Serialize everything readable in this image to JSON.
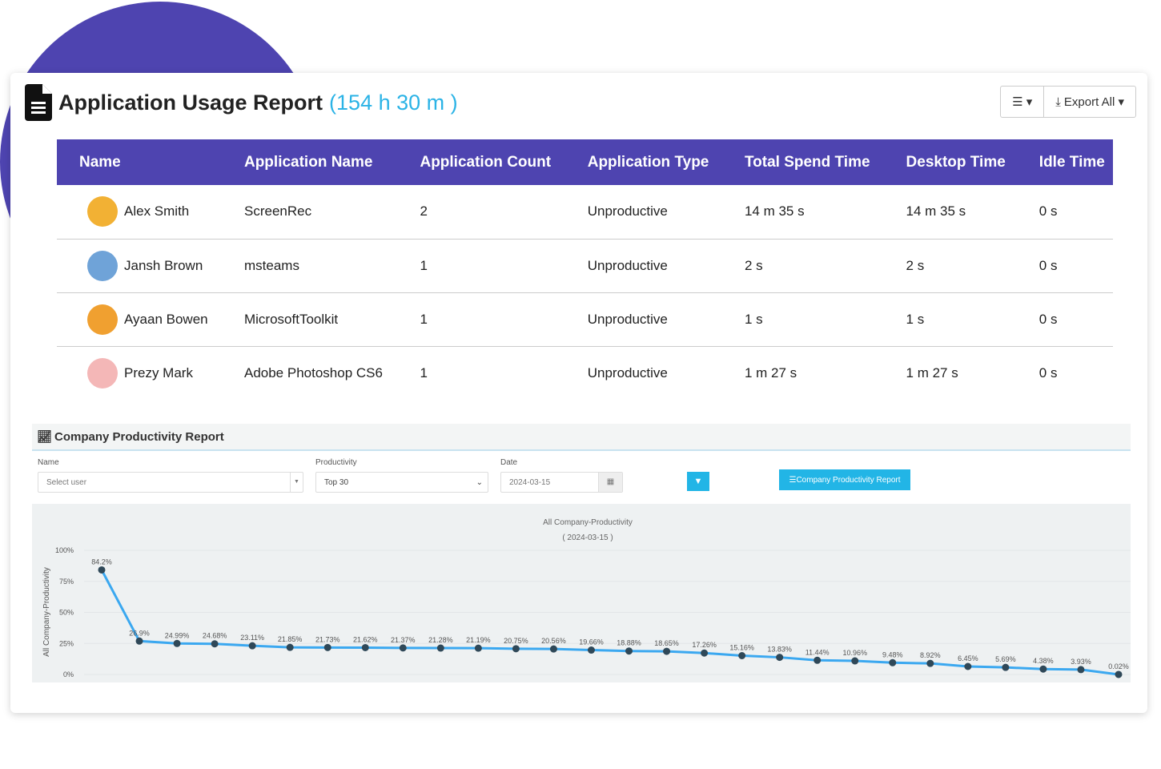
{
  "header": {
    "title": "Application Usage Report",
    "total": "(154 h 30 m )",
    "export_label": "Export All",
    "icons": [
      "document-icon",
      "list-icon",
      "export-icon"
    ]
  },
  "table": {
    "columns": [
      "Name",
      "Application Name",
      "Application Count",
      "Application Type",
      "Total Spend Time",
      "Desktop Time",
      "Idle Time"
    ],
    "rows": [
      {
        "name": "Alex Smith",
        "app": "ScreenRec",
        "count": "2",
        "type": "Unproductive",
        "total": "14 m 35 s",
        "desktop": "14 m 35 s",
        "idle": "0 s",
        "avatar_color": "#F2B134"
      },
      {
        "name": "Jansh Brown",
        "app": "msteams",
        "count": "1",
        "type": "Unproductive",
        "total": "2 s",
        "desktop": "2 s",
        "idle": "0 s",
        "avatar_color": "#6FA3D8"
      },
      {
        "name": "Ayaan Bowen",
        "app": "MicrosoftToolkit",
        "count": "1",
        "type": "Unproductive",
        "total": "1 s",
        "desktop": "1 s",
        "idle": "0 s",
        "avatar_color": "#F0A030"
      },
      {
        "name": "Prezy Mark",
        "app": "Adobe Photoshop CS6",
        "count": "1",
        "type": "Unproductive",
        "total": "1 m 27 s",
        "desktop": "1 m 27 s",
        "idle": "0 s",
        "avatar_color": "#F4B7B7"
      }
    ]
  },
  "productivity": {
    "title": "Company Productivity Report",
    "name_label": "Name",
    "name_placeholder": "Select user",
    "productivity_label": "Productivity",
    "productivity_value": "Top 30",
    "date_label": "Date",
    "date_value": "2024-03-15",
    "report_button": "Company Productivity Report",
    "accent": "#22B5E6"
  },
  "chart_data": {
    "type": "line",
    "title": "All Company-Productivity",
    "subtitle": "( 2024-03-15 )",
    "ylabel": "All Company-Productivity",
    "ylim": [
      0,
      100
    ],
    "yticks": [
      "0%",
      "25%",
      "50%",
      "75%",
      "100%"
    ],
    "grid": true,
    "line_color": "#3BA8F0",
    "marker_color": "#2F4858",
    "values": [
      84.2,
      26.9,
      24.99,
      24.68,
      23.11,
      21.85,
      21.73,
      21.62,
      21.37,
      21.28,
      21.19,
      20.75,
      20.56,
      19.66,
      18.88,
      18.65,
      17.26,
      15.16,
      13.83,
      11.44,
      10.96,
      9.48,
      8.92,
      6.45,
      5.69,
      4.38,
      3.93,
      0.02
    ],
    "labels": [
      "84.2%",
      "26.9%",
      "24.99%",
      "24.68%",
      "23.11%",
      "21.85%",
      "21.73%",
      "21.62%",
      "21.37%",
      "21.28%",
      "21.19%",
      "20.75%",
      "20.56%",
      "19.66%",
      "18.88%",
      "18.65%",
      "17.26%",
      "15.16%",
      "13.83%",
      "11.44%",
      "10.96%",
      "9.48%",
      "8.92%",
      "6.45%",
      "5.69%",
      "4.38%",
      "3.93%",
      "0.02%"
    ]
  }
}
